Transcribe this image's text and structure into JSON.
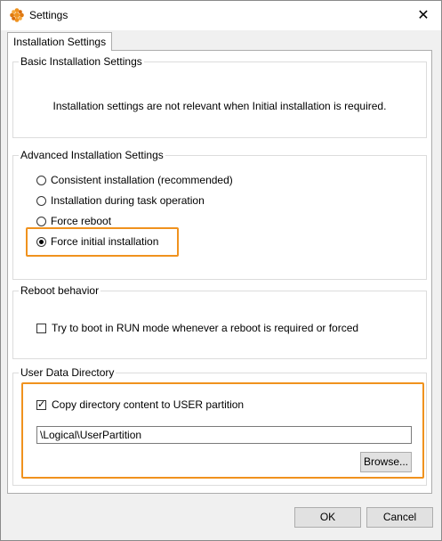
{
  "window": {
    "title": "Settings",
    "close_glyph": "✕"
  },
  "tabs": [
    {
      "label": "Installation Settings"
    }
  ],
  "basic": {
    "title": "Basic Installation Settings",
    "note": "Installation settings are not relevant when Initial installation is required."
  },
  "advanced": {
    "title": "Advanced Installation Settings",
    "options": [
      {
        "label": "Consistent installation (recommended)",
        "selected": false
      },
      {
        "label": "Installation during task operation",
        "selected": false
      },
      {
        "label": "Force reboot",
        "selected": false
      },
      {
        "label": "Force initial installation",
        "selected": true
      }
    ]
  },
  "reboot": {
    "title": "Reboot behavior",
    "checkbox_label": "Try to boot in RUN mode whenever a reboot is required or forced",
    "checked": false
  },
  "userdata": {
    "title": "User Data Directory",
    "checkbox_label": "Copy directory content to USER partition",
    "checked": true,
    "path_value": "\\Logical\\UserPartition",
    "browse_label": "Browse..."
  },
  "footer": {
    "ok_label": "OK",
    "cancel_label": "Cancel"
  },
  "colors": {
    "highlight": "#f0921e",
    "app_icon": "#f0921e"
  },
  "icons": {
    "app": "settings-app-icon",
    "close": "close-icon"
  }
}
